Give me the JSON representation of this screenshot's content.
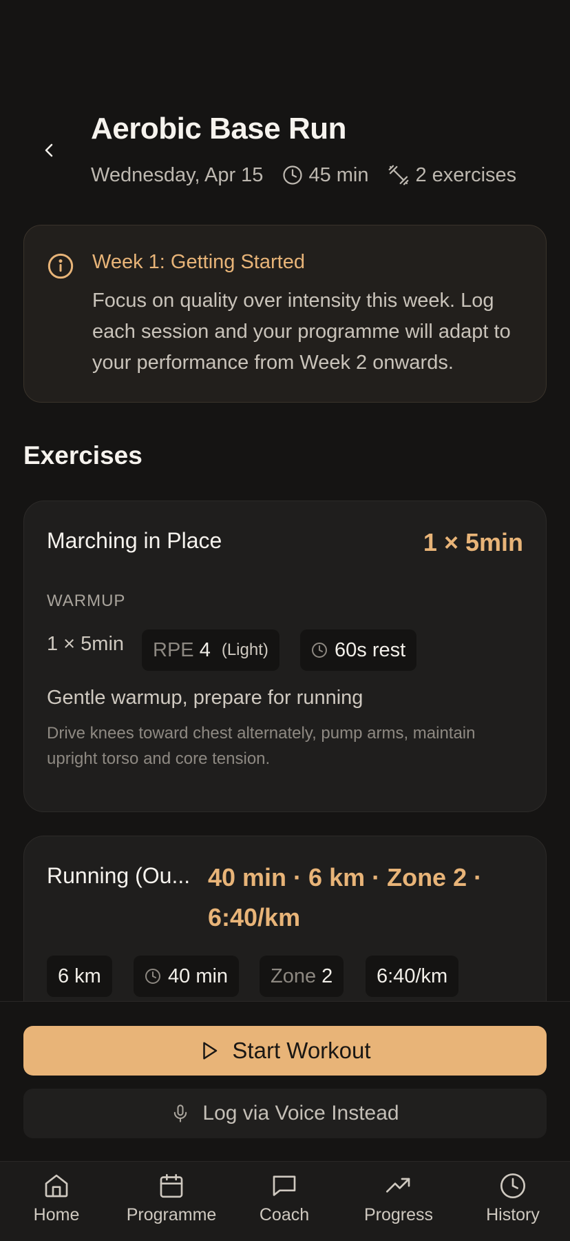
{
  "header": {
    "title": "Aerobic Base Run",
    "date": "Wednesday, Apr 15",
    "duration": "45 min",
    "exercise_count": "2 exercises"
  },
  "info": {
    "title": "Week 1: Getting Started",
    "body": "Focus on quality over intensity this week. Log each session and your programme will adapt to your performance from Week 2 onwards."
  },
  "section_title": "Exercises",
  "exercises": [
    {
      "name": "Marching in Place",
      "target": "1 × 5min",
      "category": "WARMUP",
      "sets": "1 × 5min",
      "rpe_label": "RPE",
      "rpe_value": "4",
      "rpe_desc": "(Light)",
      "rest": "60s rest",
      "description": "Gentle warmup, prepare for running",
      "note": "Drive knees toward chest alternately, pump arms, maintain upright torso and core tension."
    },
    {
      "name": "Running (Ou...",
      "target_line1": "40 min · 6 km · Zone 2 ·",
      "target_line2": "6:40/km",
      "distance": "6 km",
      "time": "40 min",
      "zone_label": "Zone",
      "zone_value": "2",
      "pace": "6:40/km"
    }
  ],
  "actions": {
    "start": "Start Workout",
    "voice": "Log via Voice Instead"
  },
  "nav": {
    "items": [
      {
        "label": "Home",
        "icon": "home-icon"
      },
      {
        "label": "Programme",
        "icon": "calendar-icon"
      },
      {
        "label": "Coach",
        "icon": "chat-icon"
      },
      {
        "label": "Progress",
        "icon": "trend-icon"
      },
      {
        "label": "History",
        "icon": "clock-icon"
      }
    ]
  },
  "colors": {
    "background": "#151413",
    "accent": "#e8b478",
    "card": "#1f1e1d",
    "info_card": "#221f1c"
  }
}
